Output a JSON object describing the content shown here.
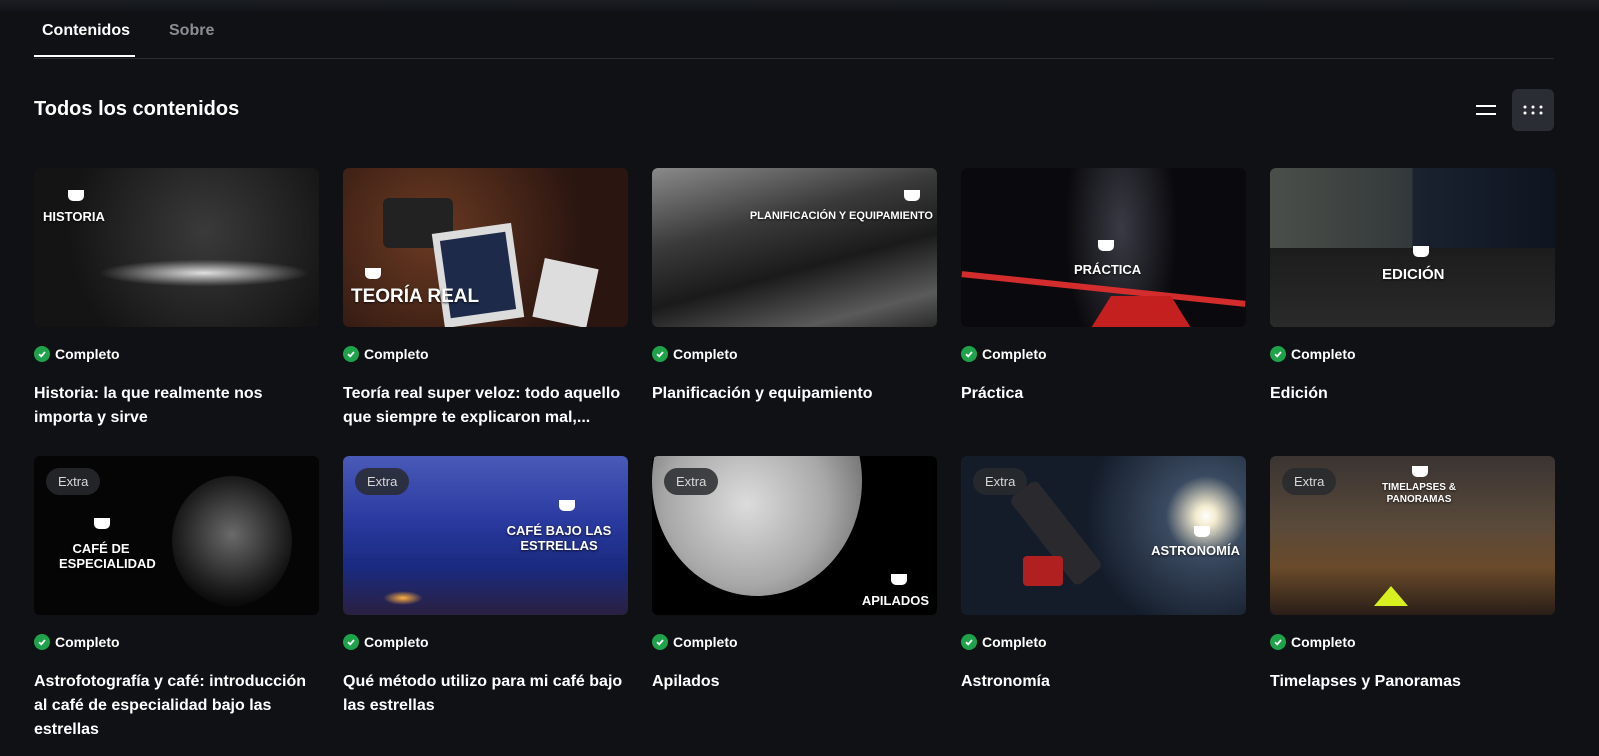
{
  "tabs": [
    {
      "label": "Contenidos",
      "active": true
    },
    {
      "label": "Sobre",
      "active": false
    }
  ],
  "section_title": "Todos los contenidos",
  "view_toggle": {
    "list_icon": "list-view-icon",
    "grid_icon": "grid-view-icon",
    "active": "grid"
  },
  "colors": {
    "background": "#0f1115",
    "complete_green": "#1fa34a",
    "badge_bg": "#282a2e"
  },
  "cards": [
    {
      "thumb_label": "HISTORIA",
      "badge": "",
      "status": "Completo",
      "title": "Historia: la que realmente nos importa y sirve"
    },
    {
      "thumb_label": "TEORÍA REAL",
      "badge": "",
      "status": "Completo",
      "title": "Teoría real super veloz: todo aquello que siempre te explicaron mal,..."
    },
    {
      "thumb_label": "PLANIFICACIÓN Y EQUIPAMIENTO",
      "badge": "",
      "status": "Completo",
      "title": "Planificación y equipamiento"
    },
    {
      "thumb_label": "PRÁCTICA",
      "badge": "",
      "status": "Completo",
      "title": "Práctica"
    },
    {
      "thumb_label": "EDICIÓN",
      "badge": "",
      "status": "Completo",
      "title": "Edición"
    },
    {
      "thumb_label": "CAFÉ DE ESPECIALIDAD",
      "badge": "Extra",
      "status": "Completo",
      "title": "Astrofotografía y café: introducción al café de especialidad bajo las estrellas"
    },
    {
      "thumb_label": "CAFÉ BAJO LAS ESTRELLAS",
      "badge": "Extra",
      "status": "Completo",
      "title": "Qué método utilizo para mi café bajo las estrellas"
    },
    {
      "thumb_label": "APILADOS",
      "badge": "Extra",
      "status": "Completo",
      "title": "Apilados"
    },
    {
      "thumb_label": "ASTRONOMÍA",
      "badge": "Extra",
      "status": "Completo",
      "title": "Astronomía"
    },
    {
      "thumb_label": "TIMELAPSES & PANORAMAS",
      "badge": "Extra",
      "status": "Completo",
      "title": "Timelapses y Panoramas"
    }
  ]
}
